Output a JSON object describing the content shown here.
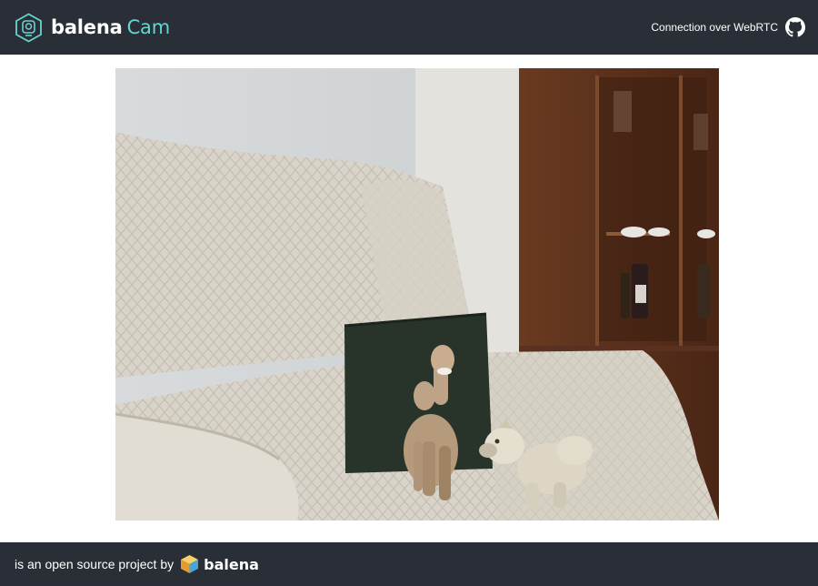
{
  "header": {
    "brand_primary": "balena",
    "brand_secondary": "Cam",
    "connection_text": "Connection over WebRTC",
    "logo_icon": "balenacam-logo-icon",
    "repo_icon": "github-icon"
  },
  "stream": {
    "description_icon": "camera-feed"
  },
  "footer": {
    "prefix_text": "is an open source project by",
    "brand_text": "balena",
    "brand_icon": "balena-cube-icon"
  },
  "colors": {
    "bar_background": "#2a2f37",
    "accent": "#66d4cf",
    "page_background": "#ffffff"
  }
}
